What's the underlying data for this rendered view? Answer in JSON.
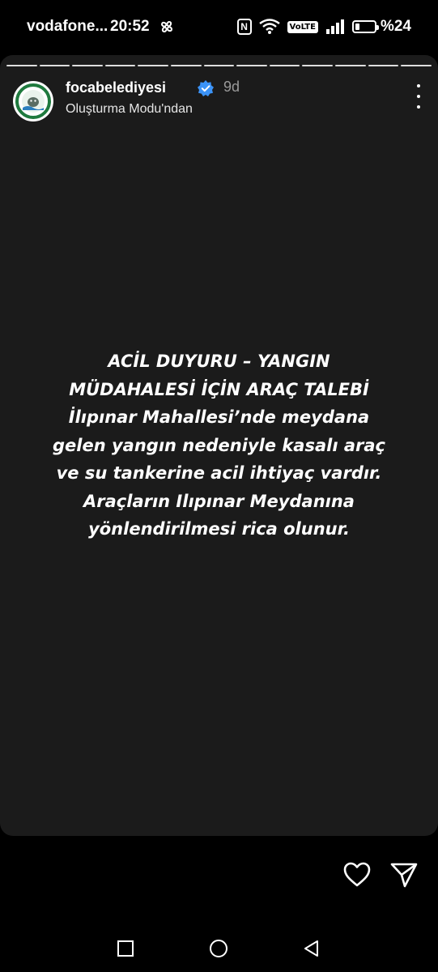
{
  "status_bar": {
    "carrier": "vodafone...",
    "time": "20:52",
    "volte": "VoLTE",
    "battery_text": "%24",
    "battery_level_percent": 24,
    "icons": [
      "fan-icon",
      "nfc-icon",
      "wifi-icon",
      "volte-icon",
      "signal-icon",
      "battery-icon"
    ]
  },
  "story": {
    "segments_count": 13,
    "username": "focabelediyesi",
    "verified": true,
    "time_ago": "9d",
    "subtitle": "Oluşturma Modu'ndan",
    "announcement": "ACİL DUYURU – YANGIN\nMÜDAHALESİ İÇİN ARAÇ TALEBİ\nİlıpınar Mahallesi’nde meydana\ngelen yangın nedeniyle kasalı araç\nve su tankerine acil ihtiyaç vardır.\nAraçların Ilıpınar Meydanına\nyönlendirilmesi rica olunur."
  },
  "actions": {
    "icons": [
      "heart-icon",
      "send-icon"
    ]
  },
  "nav_bar": {
    "icons": [
      "recents-icon",
      "home-icon",
      "back-icon"
    ]
  },
  "colors": {
    "background": "#000000",
    "story_background": "#1b1b1b",
    "secondary_text": "#9a9a9a",
    "verified_badge": "#3b93f7"
  }
}
